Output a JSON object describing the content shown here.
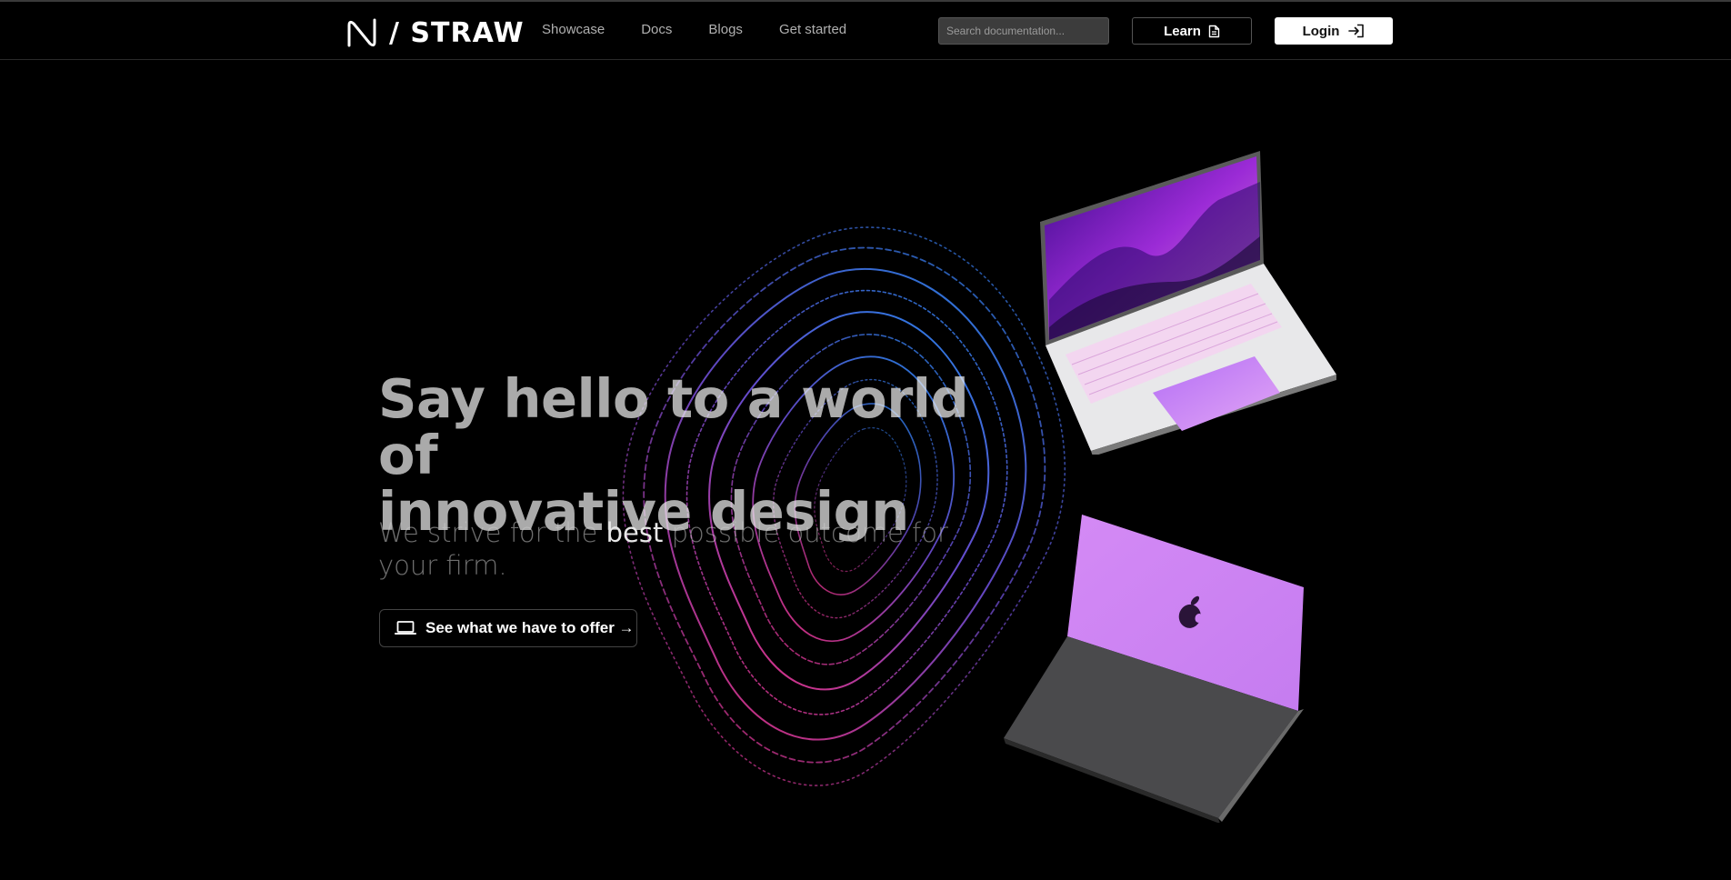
{
  "brand": {
    "name": "/ STRAW"
  },
  "nav": {
    "items": [
      {
        "label": "Showcase"
      },
      {
        "label": "Docs"
      },
      {
        "label": "Blogs"
      },
      {
        "label": "Get started"
      }
    ]
  },
  "search": {
    "placeholder": "Search documentation..."
  },
  "actions": {
    "learn_label": "Learn",
    "login_label": "Login"
  },
  "hero": {
    "title_line1": "Say hello to a world of",
    "title_line2": "innovative design",
    "subtitle_before": "We strive for the ",
    "subtitle_highlight": "best",
    "subtitle_after": " possible outcome for your firm.",
    "cta_label": "See what we have to offer →"
  },
  "colors": {
    "background": "#000000",
    "accent_blue": "#3a7bd5",
    "accent_pink": "#e0338a",
    "accent_purple": "#a855f7"
  },
  "icons": {
    "learn": "document-icon",
    "login": "login-icon",
    "cta": "laptop-icon"
  }
}
